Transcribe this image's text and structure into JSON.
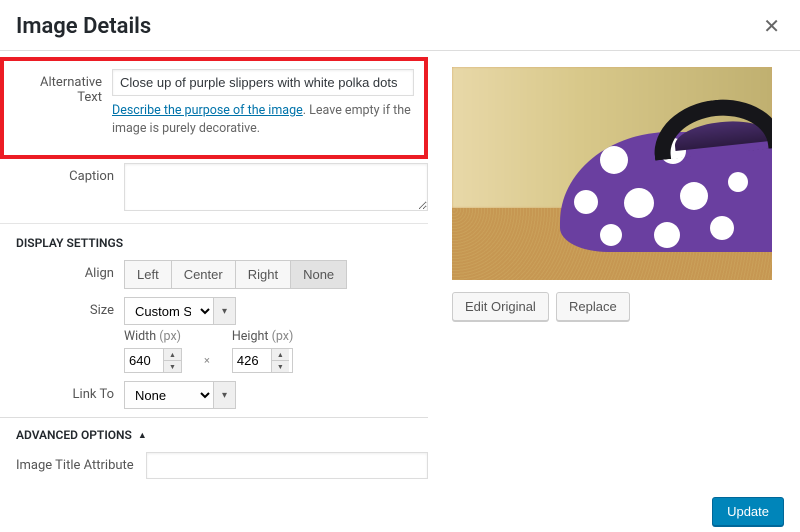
{
  "header": {
    "title": "Image Details"
  },
  "alt": {
    "label": "Alternative Text",
    "value": "Close up of purple slippers with white polka dots",
    "help_link": "Describe the purpose of the image",
    "help_rest": ". Leave empty if the image is purely decorative."
  },
  "caption": {
    "label": "Caption",
    "value": ""
  },
  "display_settings": {
    "heading": "DISPLAY SETTINGS",
    "align": {
      "label": "Align",
      "options": [
        "Left",
        "Center",
        "Right",
        "None"
      ],
      "selected": "None"
    },
    "size": {
      "label": "Size",
      "selected": "Custom Size",
      "width_label": "Width",
      "height_label": "Height",
      "unit": "(px)",
      "width": "640",
      "height": "426",
      "mult": "×"
    },
    "link_to": {
      "label": "Link To",
      "selected": "None"
    }
  },
  "advanced": {
    "heading": "ADVANCED OPTIONS"
  },
  "title_attr": {
    "label": "Image Title Attribute",
    "value": ""
  },
  "preview": {
    "edit": "Edit Original",
    "replace": "Replace"
  },
  "footer": {
    "update": "Update"
  }
}
